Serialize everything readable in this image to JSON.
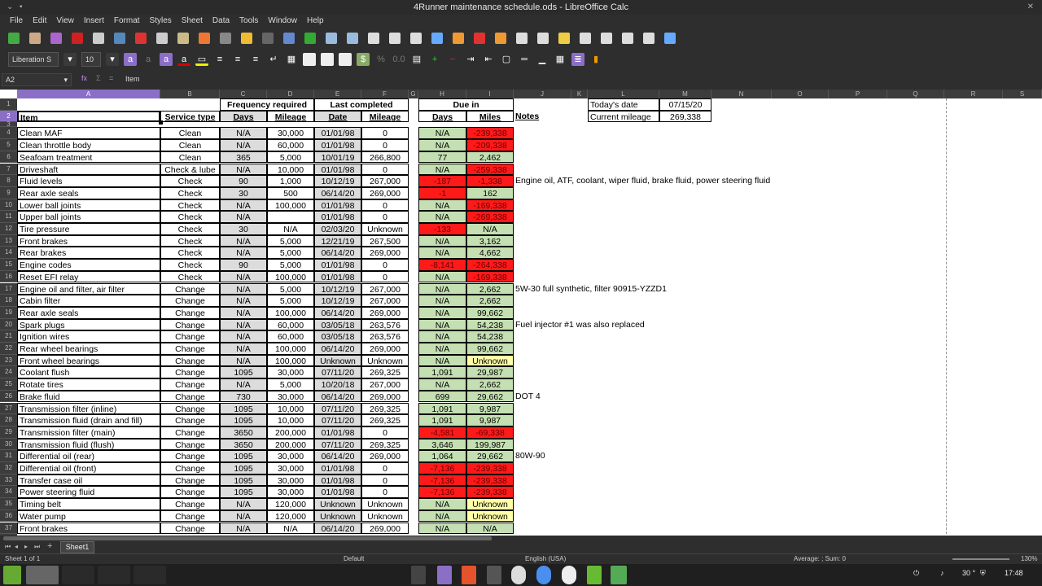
{
  "window": {
    "title": "4Runner maintenance schedule.ods - LibreOffice Calc"
  },
  "menu": [
    "File",
    "Edit",
    "View",
    "Insert",
    "Format",
    "Styles",
    "Sheet",
    "Data",
    "Tools",
    "Window",
    "Help"
  ],
  "toolbar": {
    "font_name": "Liberation S",
    "font_size": "10"
  },
  "formula_bar": {
    "cell_ref": "A2",
    "content": "Item"
  },
  "columns": [
    "A",
    "B",
    "C",
    "D",
    "E",
    "F",
    "G",
    "H",
    "I",
    "J",
    "K",
    "L",
    "M",
    "N",
    "O",
    "P",
    "Q",
    "R",
    "S"
  ],
  "colors": {
    "green": "#c4e0b2",
    "red": "#ff1a1a",
    "yellow": "#ffffa6",
    "selection": "#8b6fc7"
  },
  "headers": {
    "frequency": "Frequency required",
    "last": "Last completed",
    "due": "Due in",
    "item": "Item",
    "service": "Service type",
    "days": "Days",
    "mileage": "Mileage",
    "date": "Date",
    "last_mileage": "Mileage",
    "due_days": "Days",
    "due_miles": "Miles",
    "notes": "Notes"
  },
  "info": {
    "today_label": "Today's date",
    "today_value": "07/15/20",
    "mileage_label": "Current mileage",
    "mileage_value": "269,338"
  },
  "rows": [
    [
      "Clean MAF",
      "Clean",
      "N/A",
      "30,000",
      "01/01/98",
      "0",
      "N/A",
      "g",
      "-239,338",
      "r",
      ""
    ],
    [
      "Clean throttle body",
      "Clean",
      "N/A",
      "60,000",
      "01/01/98",
      "0",
      "N/A",
      "g",
      "-209,338",
      "r",
      ""
    ],
    [
      "Seafoam treatment",
      "Clean",
      "365",
      "5,000",
      "10/01/19",
      "266,800",
      "77",
      "g",
      "2,462",
      "g",
      ""
    ],
    [
      "Driveshaft",
      "Check & lube",
      "N/A",
      "10,000",
      "01/01/98",
      "0",
      "N/A",
      "g",
      "-259,338",
      "r",
      ""
    ],
    [
      "Fluid levels",
      "Check",
      "90",
      "1,000",
      "10/12/19",
      "267,000",
      "-187",
      "r",
      "-1,338",
      "r",
      "Engine oil, ATF, coolant, wiper fluid, brake fluid, power steering fluid"
    ],
    [
      "Rear axle seals",
      "Check",
      "30",
      "500",
      "06/14/20",
      "269,000",
      "-1",
      "r",
      "162",
      "g",
      ""
    ],
    [
      "Lower ball joints",
      "Check",
      "N/A",
      "100,000",
      "01/01/98",
      "0",
      "N/A",
      "g",
      "-169,338",
      "r",
      ""
    ],
    [
      "Upper ball joints",
      "Check",
      "N/A",
      "",
      "01/01/98",
      "0",
      "N/A",
      "g",
      "-269,338",
      "r",
      ""
    ],
    [
      "Tire pressure",
      "Check",
      "30",
      "N/A",
      "02/03/20",
      "Unknown",
      "-133",
      "r",
      "N/A",
      "g",
      ""
    ],
    [
      "Front brakes",
      "Check",
      "N/A",
      "5,000",
      "12/21/19",
      "267,500",
      "N/A",
      "g",
      "3,162",
      "g",
      ""
    ],
    [
      "Rear brakes",
      "Check",
      "N/A",
      "5,000",
      "06/14/20",
      "269,000",
      "N/A",
      "g",
      "4,662",
      "g",
      ""
    ],
    [
      "Engine codes",
      "Check",
      "90",
      "5,000",
      "01/01/98",
      "0",
      "-8,141",
      "r",
      "-264,338",
      "r",
      ""
    ],
    [
      "Reset EFI relay",
      "Check",
      "N/A",
      "100,000",
      "01/01/98",
      "0",
      "N/A",
      "g",
      "-169,338",
      "r",
      ""
    ],
    [
      "Engine oil and filter, air filter",
      "Change",
      "N/A",
      "5,000",
      "10/12/19",
      "267,000",
      "N/A",
      "g",
      "2,662",
      "g",
      "5W-30 full synthetic, filter 90915-YZZD1"
    ],
    [
      "Cabin filter",
      "Change",
      "N/A",
      "5,000",
      "10/12/19",
      "267,000",
      "N/A",
      "g",
      "2,662",
      "g",
      ""
    ],
    [
      "Rear axle seals",
      "Change",
      "N/A",
      "100,000",
      "06/14/20",
      "269,000",
      "N/A",
      "g",
      "99,662",
      "g",
      ""
    ],
    [
      "Spark plugs",
      "Change",
      "N/A",
      "60,000",
      "03/05/18",
      "263,576",
      "N/A",
      "g",
      "54,238",
      "g",
      "Fuel injector #1 was also replaced"
    ],
    [
      "Ignition wires",
      "Change",
      "N/A",
      "60,000",
      "03/05/18",
      "263,576",
      "N/A",
      "g",
      "54,238",
      "g",
      ""
    ],
    [
      "Rear wheel bearings",
      "Change",
      "N/A",
      "100,000",
      "06/14/20",
      "269,000",
      "N/A",
      "g",
      "99,662",
      "g",
      ""
    ],
    [
      "Front wheel bearings",
      "Change",
      "N/A",
      "100,000",
      "Unknown",
      "Unknown",
      "N/A",
      "g",
      "Unknown",
      "y",
      ""
    ],
    [
      "Coolant flush",
      "Change",
      "1095",
      "30,000",
      "07/11/20",
      "269,325",
      "1,091",
      "g",
      "29,987",
      "g",
      ""
    ],
    [
      "Rotate tires",
      "Change",
      "N/A",
      "5,000",
      "10/20/18",
      "267,000",
      "N/A",
      "g",
      "2,662",
      "g",
      ""
    ],
    [
      "Brake fluid",
      "Change",
      "730",
      "30,000",
      "06/14/20",
      "269,000",
      "699",
      "g",
      "29,662",
      "g",
      "DOT 4"
    ],
    [
      "Transmission filter (inline)",
      "Change",
      "1095",
      "10,000",
      "07/11/20",
      "269,325",
      "1,091",
      "g",
      "9,987",
      "g",
      ""
    ],
    [
      "Transmission fluid (drain and fill)",
      "Change",
      "1095",
      "10,000",
      "07/11/20",
      "269,325",
      "1,091",
      "g",
      "9,987",
      "g",
      ""
    ],
    [
      "Transmission filter (main)",
      "Change",
      "3650",
      "200,000",
      "01/01/98",
      "0",
      "-4,581",
      "r",
      "-69,338",
      "r",
      ""
    ],
    [
      "Transmission fluid (flush)",
      "Change",
      "3650",
      "200,000",
      "07/11/20",
      "269,325",
      "3,646",
      "g",
      "199,987",
      "g",
      ""
    ],
    [
      "Differential oil (rear)",
      "Change",
      "1095",
      "30,000",
      "06/14/20",
      "269,000",
      "1,064",
      "g",
      "29,662",
      "g",
      "80W-90"
    ],
    [
      "Differential oil (front)",
      "Change",
      "1095",
      "30,000",
      "01/01/98",
      "0",
      "-7,136",
      "r",
      "-239,338",
      "r",
      ""
    ],
    [
      "Transfer case oil",
      "Change",
      "1095",
      "30,000",
      "01/01/98",
      "0",
      "-7,136",
      "r",
      "-239,338",
      "r",
      ""
    ],
    [
      "Power steering fluid",
      "Change",
      "1095",
      "30,000",
      "01/01/98",
      "0",
      "-7,136",
      "r",
      "-239,338",
      "r",
      ""
    ],
    [
      "Timing belt",
      "Change",
      "N/A",
      "120,000",
      "Unknown",
      "Unknown",
      "N/A",
      "g",
      "Unknown",
      "y",
      ""
    ],
    [
      "Water pump",
      "Change",
      "N/A",
      "120,000",
      "Unknown",
      "Unknown",
      "N/A",
      "g",
      "Unknown",
      "y",
      ""
    ],
    [
      "Front brakes",
      "Change",
      "N/A",
      "N/A",
      "06/14/20",
      "269,000",
      "N/A",
      "g",
      "N/A",
      "g",
      ""
    ]
  ],
  "sheet_tab": "Sheet1",
  "status": {
    "sheet": "Sheet 1 of 1",
    "style": "Default",
    "language": "English (USA)",
    "summary": "Average: ; Sum: 0",
    "zoom": "130%"
  },
  "tray": {
    "temp": "30 °",
    "time": "17:48"
  }
}
